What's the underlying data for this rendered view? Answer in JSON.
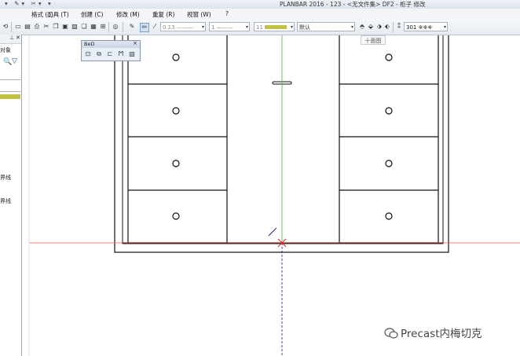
{
  "window": {
    "title": "PLANBAR 2016 - 123 - <无文件集> DF2 - 柜子 修改"
  },
  "menu": {
    "items": [
      "格式 (o)",
      "工具 (T)",
      "创建 (C)",
      "修改 (M)",
      "重复 (R)",
      "视窗 (W)",
      "?"
    ]
  },
  "toolbar": {
    "pen_thickness": "0.13",
    "line_type": "1",
    "color_number": "11",
    "layer": "默认",
    "scale_value": "301",
    "hatch_pattern": "※※※"
  },
  "tooltip": {
    "text": "十面图"
  },
  "float_toolbar": {
    "title": "BeD"
  },
  "side_panel": {
    "labels": [
      "对象",
      "界线",
      "界线"
    ]
  },
  "watermark": {
    "text": "Precast内梅切克"
  },
  "colors": {
    "accent_yellow": "#c3c144",
    "axis_red": "#ff0000",
    "axis_green": "#00c000",
    "crosshair_dark": "#000080"
  }
}
